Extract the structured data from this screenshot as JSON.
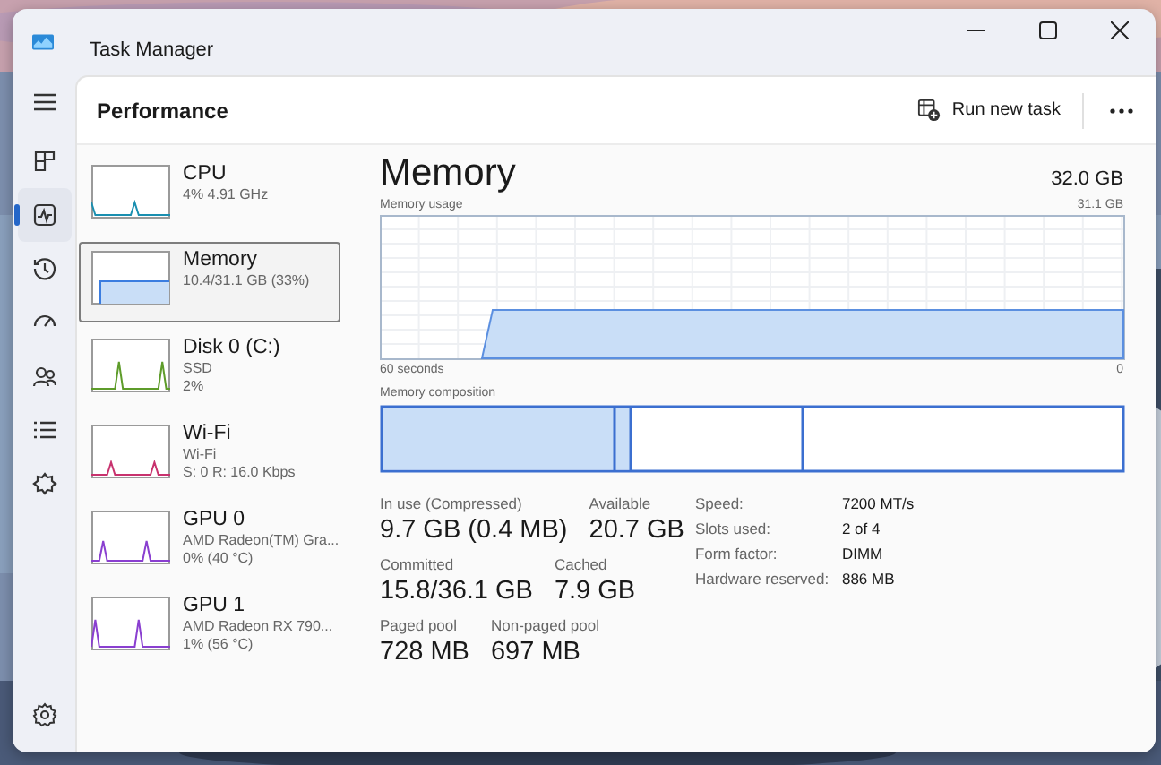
{
  "window": {
    "title": "Task Manager"
  },
  "nav": [
    {
      "kind": "menu",
      "selected": false
    },
    {
      "kind": "processes",
      "selected": false
    },
    {
      "kind": "performance",
      "selected": true
    },
    {
      "kind": "history",
      "selected": false
    },
    {
      "kind": "startup",
      "selected": false
    },
    {
      "kind": "users",
      "selected": false
    },
    {
      "kind": "details",
      "selected": false
    },
    {
      "kind": "services",
      "selected": false
    }
  ],
  "header": {
    "title": "Performance",
    "run_new_task": "Run new task"
  },
  "devices": [
    {
      "name": "CPU",
      "lines": [
        "4% 4.91 GHz"
      ],
      "color": "#1a8fb0",
      "selected": false
    },
    {
      "name": "Memory",
      "lines": [
        "10.4/31.1 GB (33%)"
      ],
      "color": "#3b7de0",
      "selected": true
    },
    {
      "name": "Disk 0 (C:)",
      "lines": [
        "SSD",
        "2%"
      ],
      "color": "#5e9c2a",
      "selected": false
    },
    {
      "name": "Wi-Fi",
      "lines": [
        "Wi-Fi",
        "S: 0 R: 16.0 Kbps"
      ],
      "color": "#c8326e",
      "selected": false
    },
    {
      "name": "GPU 0",
      "lines": [
        "AMD Radeon(TM) Gra...",
        "0% (40 °C)"
      ],
      "color": "#8a3fd0",
      "selected": false
    },
    {
      "name": "GPU 1",
      "lines": [
        "AMD Radeon RX 790...",
        "1% (56 °C)"
      ],
      "color": "#8a3fd0",
      "selected": false
    }
  ],
  "detail": {
    "title": "Memory",
    "total": "32.0 GB",
    "usage_label": "Memory usage",
    "usage_max": "31.1 GB",
    "time_start": "60 seconds",
    "time_end": "0",
    "composition_label": "Memory composition",
    "stat_rows": [
      [
        {
          "label": "In use (Compressed)",
          "value": "9.7 GB (0.4 MB)"
        },
        {
          "label": "Available",
          "value": "20.7 GB"
        }
      ],
      [
        {
          "label": "Committed",
          "value": "15.8/36.1 GB"
        },
        {
          "label": "Cached",
          "value": "7.9 GB"
        }
      ],
      [
        {
          "label": "Paged pool",
          "value": "728 MB"
        },
        {
          "label": "Non-paged pool",
          "value": "697 MB"
        }
      ]
    ],
    "specs": [
      {
        "label": "Speed:",
        "value": "7200 MT/s"
      },
      {
        "label": "Slots used:",
        "value": "2 of 4"
      },
      {
        "label": "Form factor:",
        "value": "DIMM"
      },
      {
        "label": "Hardware reserved:",
        "value": "886 MB"
      }
    ]
  }
}
